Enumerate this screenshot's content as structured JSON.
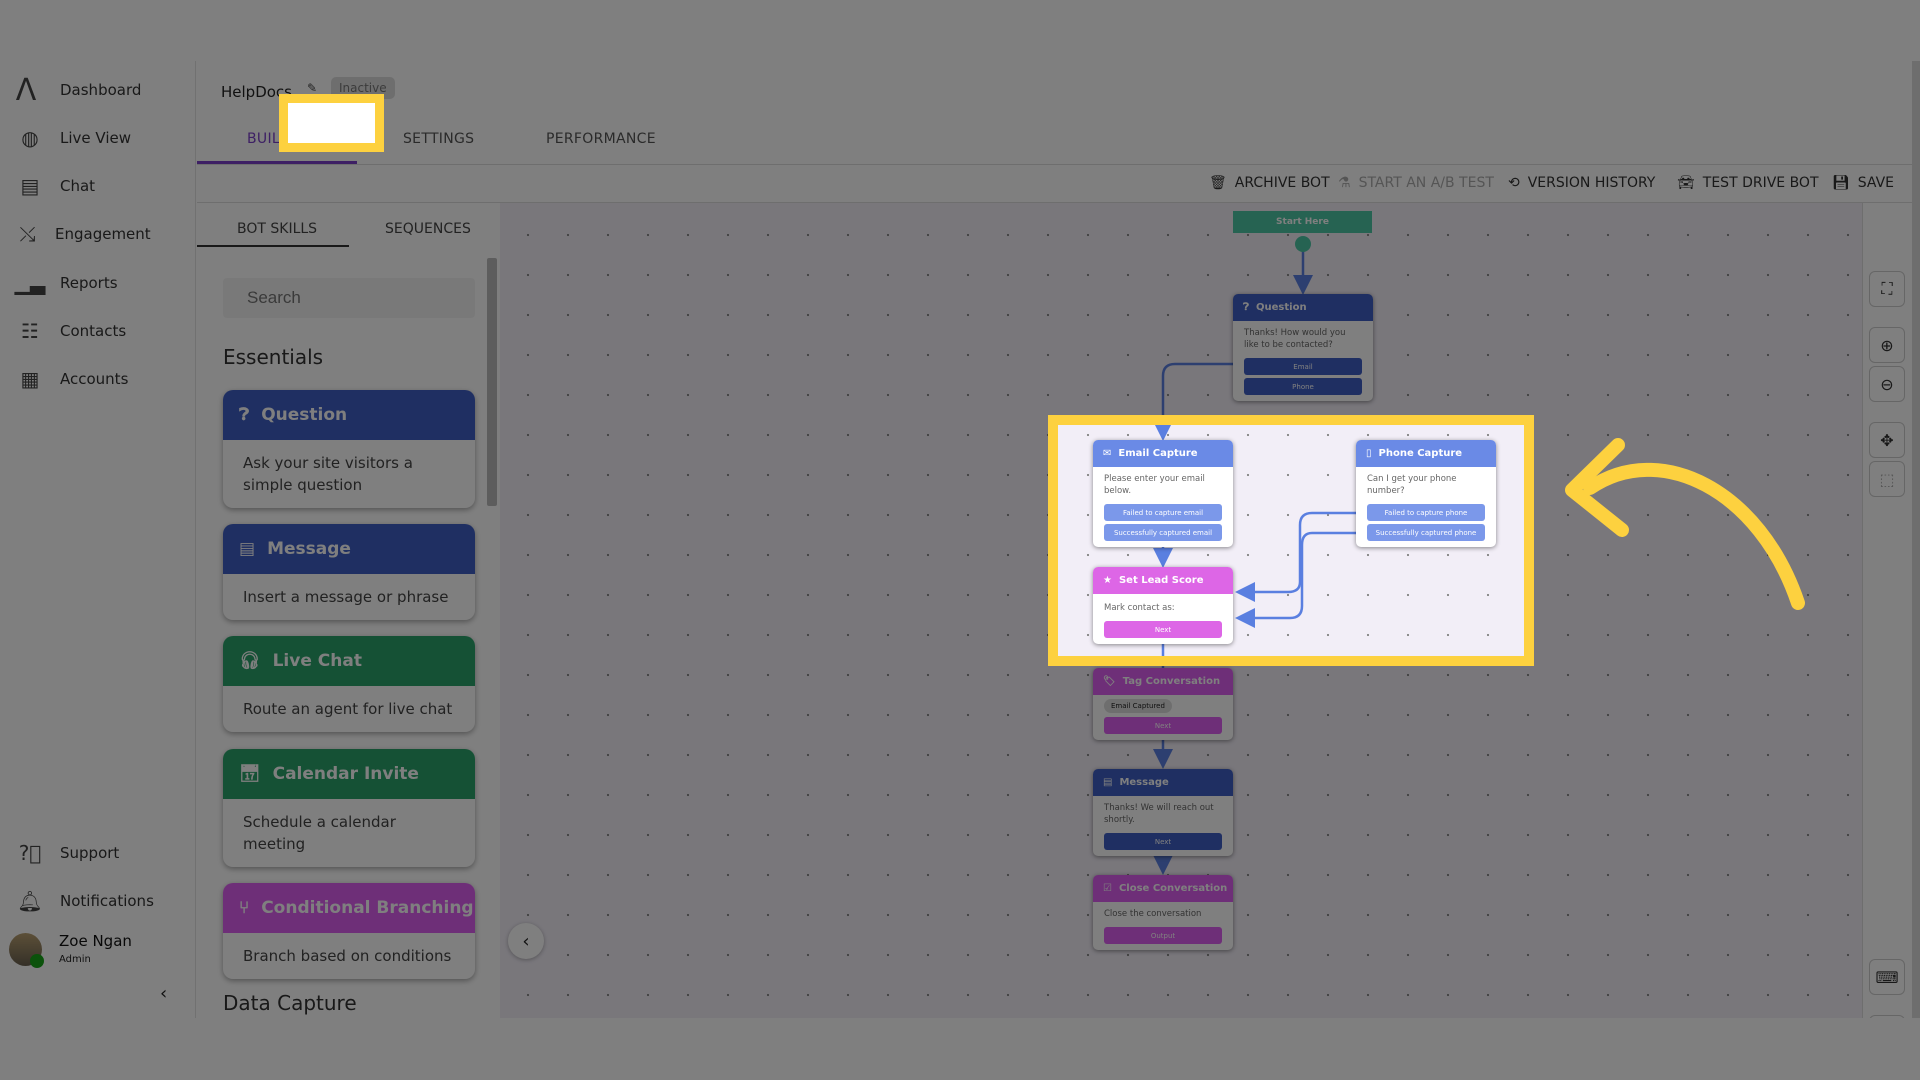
{
  "sidebar": {
    "items": [
      {
        "label": "Dashboard",
        "icon": "logo-icon"
      },
      {
        "label": "Live View",
        "icon": "globe-search-icon"
      },
      {
        "label": "Chat",
        "icon": "chat-icon"
      },
      {
        "label": "Engagement",
        "icon": "engagement-icon"
      },
      {
        "label": "Reports",
        "icon": "bar-chart-icon"
      },
      {
        "label": "Contacts",
        "icon": "contacts-icon"
      },
      {
        "label": "Accounts",
        "icon": "building-icon"
      }
    ],
    "bottom": [
      {
        "label": "Support",
        "icon": "help-icon"
      },
      {
        "label": "Notifications",
        "icon": "bell-icon"
      }
    ],
    "user": {
      "name": "Zoe Ngan",
      "role": "Admin"
    }
  },
  "header": {
    "bot_name": "HelpDocs",
    "status": "Inactive",
    "tabs": [
      "BUILDER",
      "SETTINGS",
      "PERFORMANCE"
    ],
    "active_tab": "BUILDER"
  },
  "toolbar": {
    "archive": "ARCHIVE BOT",
    "ab_test": "START AN A/B TEST",
    "version": "VERSION HISTORY",
    "test_drive": "TEST DRIVE BOT",
    "save": "SAVE"
  },
  "panel": {
    "tabs": [
      "BOT SKILLS",
      "SEQUENCES"
    ],
    "search_placeholder": "Search",
    "section": "Essentials",
    "next_section": "Data Capture",
    "cards": [
      {
        "title": "Question",
        "desc": "Ask your site visitors a simple question",
        "color": "#3f5fc4"
      },
      {
        "title": "Message",
        "desc": "Insert a message or phrase",
        "color": "#3f5fc4"
      },
      {
        "title": "Live Chat",
        "desc": "Route an agent for live chat",
        "color": "#2aa36a"
      },
      {
        "title": "Calendar Invite",
        "desc": "Schedule a calendar meeting",
        "color": "#2aa36a"
      },
      {
        "title": "Conditional Branching",
        "desc": "Branch based on conditions",
        "color": "#dc5ef0"
      }
    ]
  },
  "flow": {
    "start": "Start Here",
    "question": {
      "title": "Question",
      "text": "Thanks! How would you like to be contacted?",
      "options": [
        "Email",
        "Phone"
      ]
    },
    "email_capture": {
      "title": "Email Capture",
      "text": "Please enter your email below.",
      "options": [
        "Failed to capture email",
        "Successfully captured email"
      ]
    },
    "phone_capture": {
      "title": "Phone Capture",
      "text": "Can I get your phone number?",
      "options": [
        "Failed to capture phone",
        "Successfully captured phone"
      ]
    },
    "lead_score": {
      "title": "Set Lead Score",
      "text": "Mark contact as:",
      "button": "Next"
    },
    "tag": {
      "title": "Tag Conversation",
      "tag": "Email Captured",
      "button": "Next"
    },
    "message": {
      "title": "Message",
      "text": "Thanks! We will reach out shortly.",
      "button": "Next"
    },
    "close": {
      "title": "Close Conversation",
      "text": "Close the conversation",
      "button": "Output"
    }
  },
  "colors": {
    "accent": "#7b3fc9",
    "highlight": "#fdd13f",
    "blue": "#3f5fc4",
    "light_blue": "#6a8ae6",
    "magenta": "#dc5ef0",
    "green": "#4cc7a5"
  }
}
